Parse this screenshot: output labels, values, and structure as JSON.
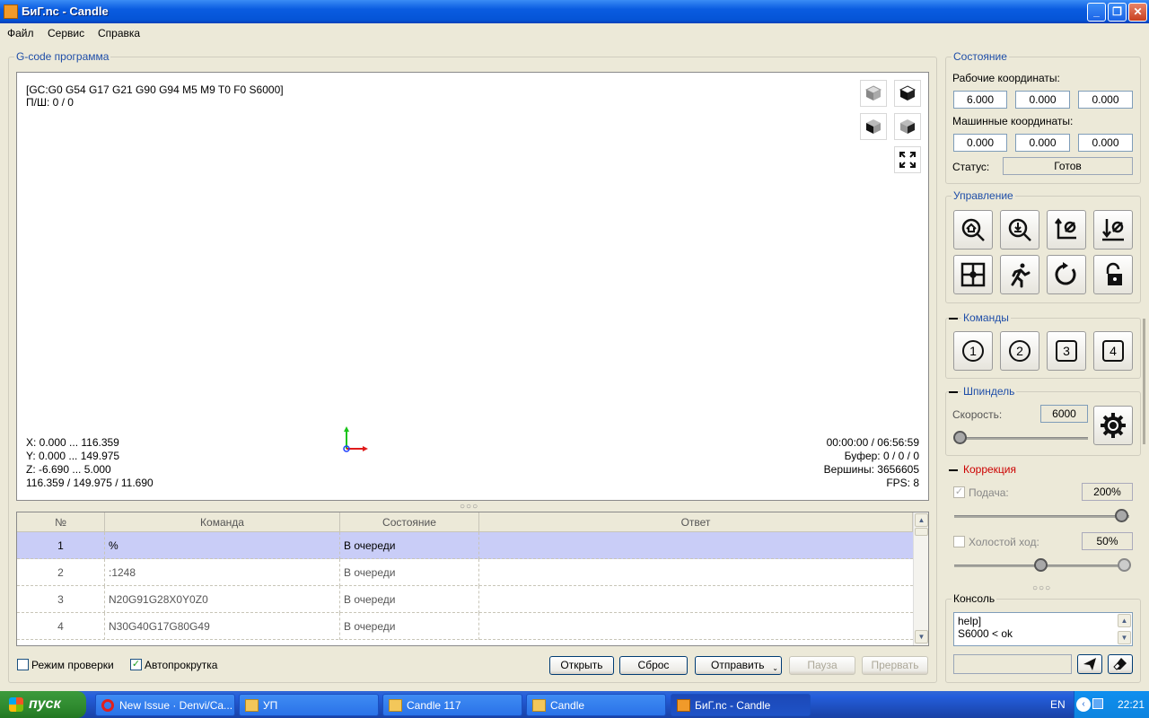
{
  "window": {
    "title": "БиГ.nc - Candle"
  },
  "menu": [
    "Файл",
    "Сервис",
    "Справка"
  ],
  "program": {
    "group_title": "G-code программа",
    "overlay": {
      "gc_line": "[GC:G0 G54 G17 G21 G90 G94 M5 M9 T0 F0 S6000]",
      "ps_line": "П/Ш: 0 / 0",
      "x_range": "X: 0.000 ... 116.359",
      "y_range": "Y: 0.000 ... 149.975",
      "z_range": "Z: -6.690 ... 5.000",
      "size": "116.359 / 149.975 / 11.690",
      "time": "00:00:00 / 06:56:59",
      "buffer": "Буфер: 0 / 0 / 0",
      "vertices": "Вершины: 3656605",
      "fps": "FPS: 8"
    },
    "table": {
      "headers": [
        "№",
        "Команда",
        "Состояние",
        "Ответ"
      ],
      "rows": [
        {
          "n": "1",
          "cmd": "%",
          "state": "В очереди",
          "resp": ""
        },
        {
          "n": "2",
          "cmd": ":1248",
          "state": "В очереди",
          "resp": ""
        },
        {
          "n": "3",
          "cmd": "N20G91G28X0Y0Z0",
          "state": "В очереди",
          "resp": ""
        },
        {
          "n": "4",
          "cmd": "N30G40G17G80G49",
          "state": "В очереди",
          "resp": ""
        }
      ]
    },
    "check_mode": "Режим проверки",
    "autoscroll": "Автопрокрутка",
    "buttons": {
      "open": "Открыть",
      "reset": "Сброс",
      "send": "Отправить",
      "pause": "Пауза",
      "abort": "Прервать"
    }
  },
  "state": {
    "title": "Состояние",
    "work_label": "Рабочие координаты:",
    "work": [
      "6.000",
      "0.000",
      "0.000"
    ],
    "machine_label": "Машинные координаты:",
    "machine": [
      "0.000",
      "0.000",
      "0.000"
    ],
    "status_label": "Статус:",
    "status": "Готов"
  },
  "control": {
    "title": "Управление"
  },
  "commands": {
    "title": "Команды",
    "items": [
      "1",
      "2",
      "3",
      "4"
    ]
  },
  "spindle": {
    "title": "Шпиндель",
    "speed_label": "Скорость:",
    "speed": "6000",
    "slider_fraction": 0
  },
  "correction": {
    "title": "Коррекция",
    "feed_label": "Подача:",
    "feed": "200%",
    "feed_fraction": 1,
    "rapid_label": "Холостой ход:",
    "rapid": "50%",
    "rapid_fraction": 0.5
  },
  "console": {
    "title": "Консоль",
    "lines": [
      "help]",
      "S6000 < ok"
    ]
  },
  "taskbar": {
    "start": "пуск",
    "items": [
      "New Issue · Denvi/Ca...",
      "УП",
      "Candle 117",
      "Candle",
      "БиГ.nc - Candle"
    ],
    "lang": "EN",
    "clock": "22:21"
  },
  "colors": {
    "accent": "#1f4ea8",
    "correction_title": "#cc0000",
    "selected_row": "#c9cdf7"
  }
}
